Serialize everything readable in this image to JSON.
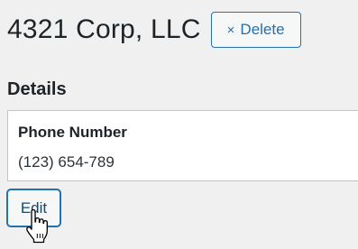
{
  "header": {
    "title": "4321 Corp, LLC",
    "delete_icon": "×",
    "delete_label": "Delete"
  },
  "details": {
    "heading": "Details",
    "fields": [
      {
        "label": "Phone Number",
        "value": "(123) 654-789"
      }
    ]
  },
  "actions": {
    "edit_label": "Edit"
  },
  "icons": {
    "delete": "close-icon",
    "cursor": "hand-pointer-cursor-icon"
  },
  "colors": {
    "accent": "#2271b1",
    "background": "#f0f0f1",
    "card": "#ffffff",
    "text": "#1d2327"
  }
}
